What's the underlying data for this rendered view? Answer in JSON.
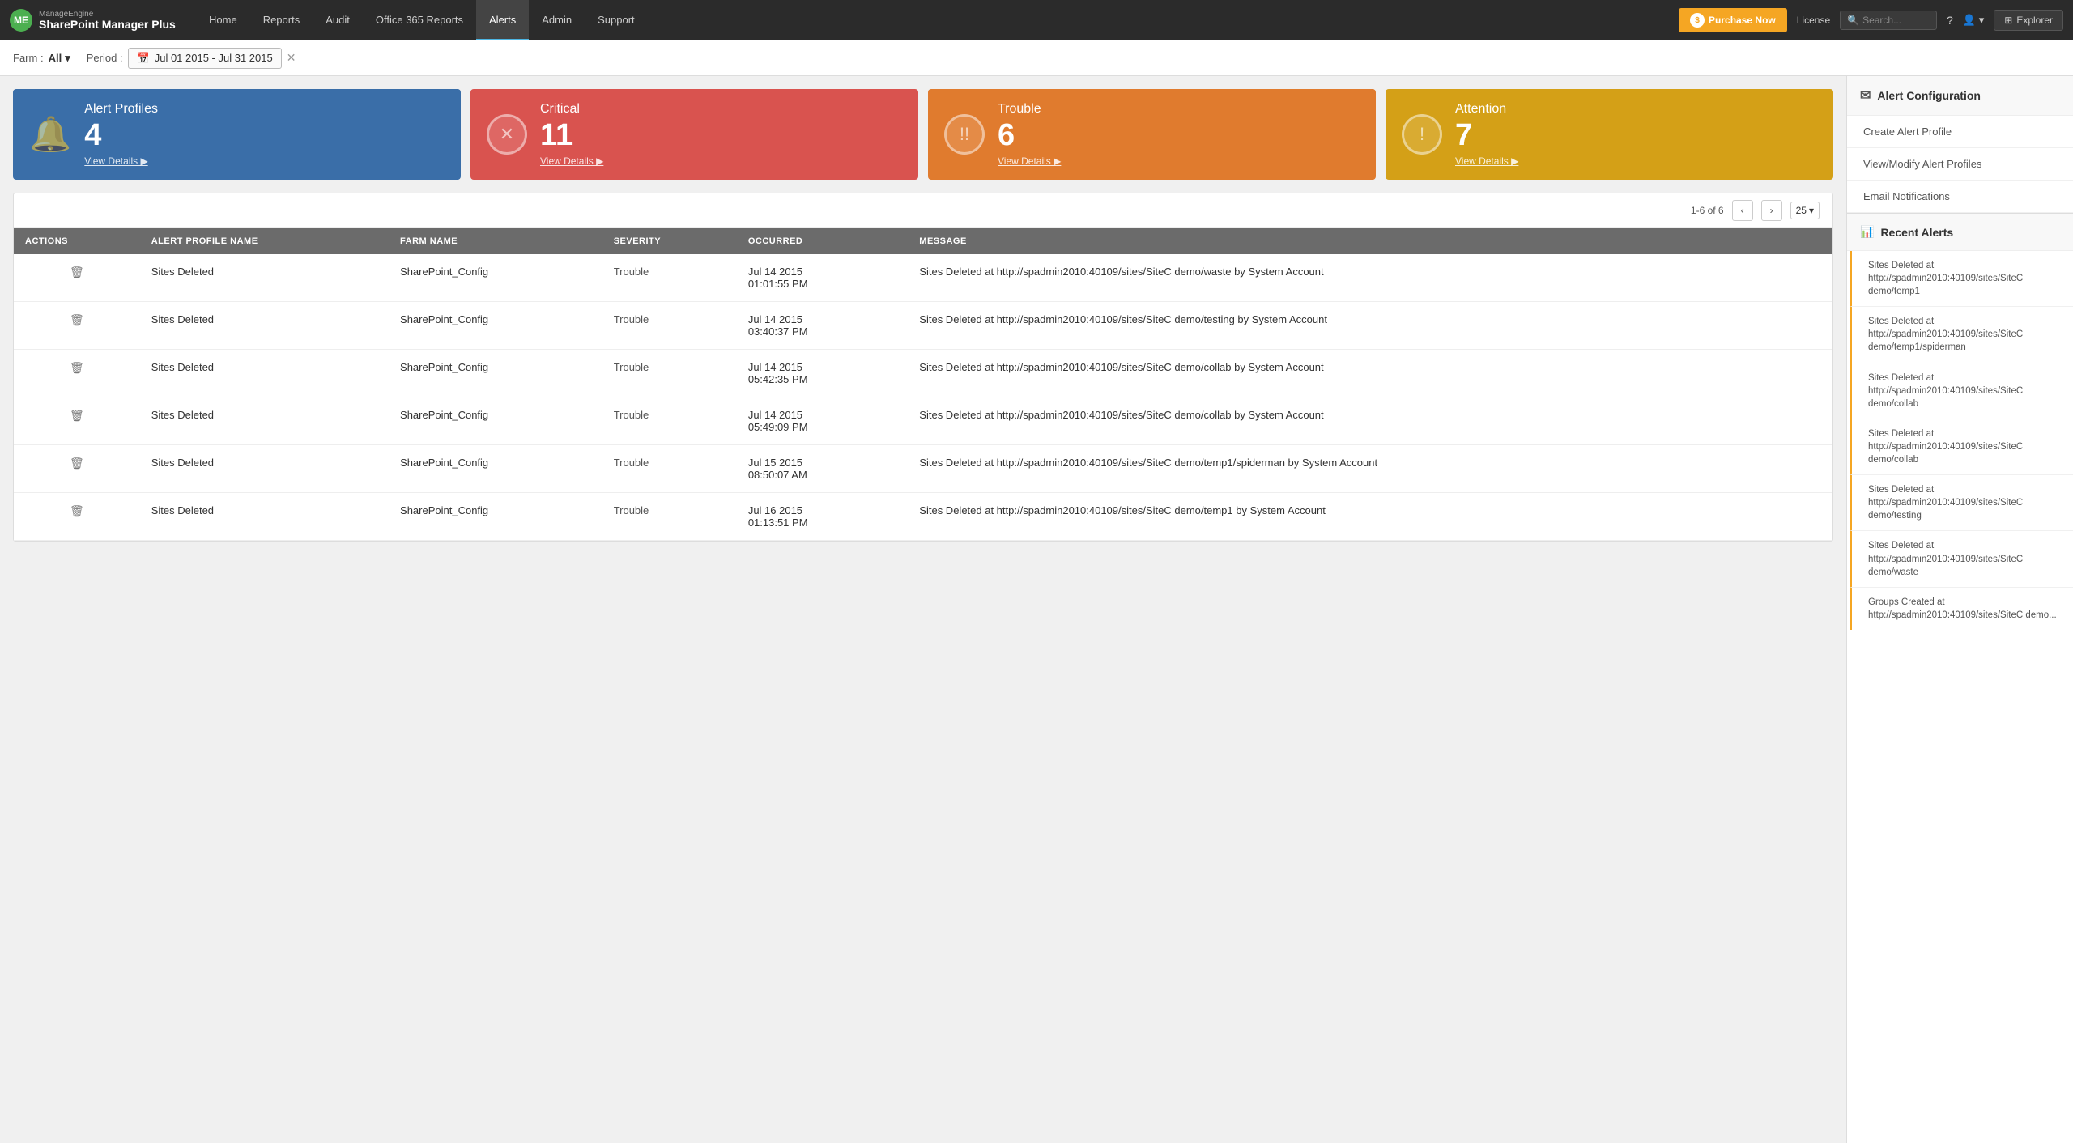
{
  "app": {
    "brand_manage": "ManageEngine",
    "brand_name": "SharePoint Manager Plus"
  },
  "nav": {
    "items": [
      {
        "label": "Home",
        "active": false
      },
      {
        "label": "Reports",
        "active": false
      },
      {
        "label": "Audit",
        "active": false
      },
      {
        "label": "Office 365 Reports",
        "active": false
      },
      {
        "label": "Alerts",
        "active": true
      },
      {
        "label": "Admin",
        "active": false
      },
      {
        "label": "Support",
        "active": false
      }
    ]
  },
  "topbar": {
    "purchase_label": "Purchase Now",
    "license_label": "License",
    "search_placeholder": "Search...",
    "explorer_label": "Explorer"
  },
  "filter": {
    "farm_label": "Farm :",
    "farm_value": "All",
    "period_label": "Period :",
    "date_range": "Jul 01 2015 - Jul 31 2015"
  },
  "summary_cards": [
    {
      "type": "alert_profiles",
      "color": "blue",
      "title": "Alert Profiles",
      "count": "4",
      "link": "View Details"
    },
    {
      "type": "critical",
      "color": "red",
      "title": "Critical",
      "count": "11",
      "link": "View Details"
    },
    {
      "type": "trouble",
      "color": "orange",
      "title": "Trouble",
      "count": "6",
      "link": "View Details"
    },
    {
      "type": "attention",
      "color": "yellow",
      "title": "Attention",
      "count": "7",
      "link": "View Details"
    }
  ],
  "table": {
    "pagination": "1-6 of 6",
    "page_size": "25",
    "columns": [
      "ACTIONS",
      "ALERT PROFILE NAME",
      "FARM NAME",
      "SEVERITY",
      "OCCURRED",
      "MESSAGE"
    ],
    "rows": [
      {
        "alert_profile": "Sites Deleted",
        "farm": "SharePoint_Config",
        "severity": "Trouble",
        "occurred": "Jul 14 2015\n01:01:55 PM",
        "message": "Sites Deleted at http://spadmin2010:40109/sites/SiteC demo/waste by System Account"
      },
      {
        "alert_profile": "Sites Deleted",
        "farm": "SharePoint_Config",
        "severity": "Trouble",
        "occurred": "Jul 14 2015\n03:40:37 PM",
        "message": "Sites Deleted at http://spadmin2010:40109/sites/SiteC demo/testing by System Account"
      },
      {
        "alert_profile": "Sites Deleted",
        "farm": "SharePoint_Config",
        "severity": "Trouble",
        "occurred": "Jul 14 2015\n05:42:35 PM",
        "message": "Sites Deleted at http://spadmin2010:40109/sites/SiteC demo/collab by System Account"
      },
      {
        "alert_profile": "Sites Deleted",
        "farm": "SharePoint_Config",
        "severity": "Trouble",
        "occurred": "Jul 14 2015\n05:49:09 PM",
        "message": "Sites Deleted at http://spadmin2010:40109/sites/SiteC demo/collab by System Account"
      },
      {
        "alert_profile": "Sites Deleted",
        "farm": "SharePoint_Config",
        "severity": "Trouble",
        "occurred": "Jul 15 2015\n08:50:07 AM",
        "message": "Sites Deleted at http://spadmin2010:40109/sites/SiteC demo/temp1/spiderman by System Account"
      },
      {
        "alert_profile": "Sites Deleted",
        "farm": "SharePoint_Config",
        "severity": "Trouble",
        "occurred": "Jul 16 2015\n01:13:51 PM",
        "message": "Sites Deleted at http://spadmin2010:40109/sites/SiteC demo/temp1 by System Account"
      }
    ]
  },
  "sidebar": {
    "config_header": "Alert Configuration",
    "config_links": [
      {
        "label": "Create Alert Profile"
      },
      {
        "label": "View/Modify Alert Profiles"
      },
      {
        "label": "Email Notifications"
      }
    ],
    "recent_alerts_header": "Recent Alerts",
    "recent_alerts": [
      {
        "text": "Sites Deleted at http://spadmin2010:40109/sites/SiteC demo/temp1"
      },
      {
        "text": "Sites Deleted at http://spadmin2010:40109/sites/SiteC demo/temp1/spiderman"
      },
      {
        "text": "Sites Deleted at http://spadmin2010:40109/sites/SiteC demo/collab"
      },
      {
        "text": "Sites Deleted at http://spadmin2010:40109/sites/SiteC demo/collab"
      },
      {
        "text": "Sites Deleted at http://spadmin2010:40109/sites/SiteC demo/testing"
      },
      {
        "text": "Sites Deleted at http://spadmin2010:40109/sites/SiteC demo/waste"
      },
      {
        "text": "Groups Created at http://spadmin2010:40109/sites/SiteC demo..."
      }
    ]
  }
}
